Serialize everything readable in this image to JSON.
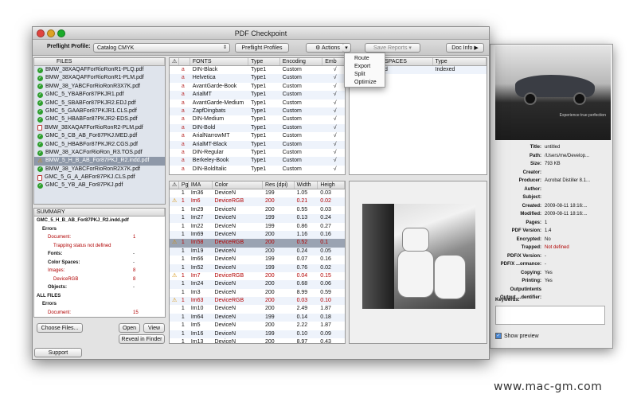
{
  "app": {
    "title": "PDF Checkpoint"
  },
  "toolbar": {
    "preflight_label": "Preflight Profile:",
    "profile_value": "Catalog CMYK",
    "preflight_profiles_button": "Preflight Profiles",
    "actions_button": "Actions",
    "save_reports_button": "Save Reports",
    "doc_info_button": "Doc Info"
  },
  "actions_menu": [
    "Route",
    "Export",
    "Split",
    "Optimize"
  ],
  "files": {
    "header": "FILES",
    "items": [
      {
        "name": "BMW_38XAQAFForRioRonR1-PLQ.pdf",
        "status": "ok"
      },
      {
        "name": "BMW_38XAQAFForRioRonR1-PLM.pdf",
        "status": "ok"
      },
      {
        "name": "BMW_38_YABCForRioRonR3X7K.pdf",
        "status": "ok"
      },
      {
        "name": "GMC_5_YBABFor87PKJR1.pdf",
        "status": "ok"
      },
      {
        "name": "GMC_5_SBABFor87PKJR2.EDJ.pdf",
        "status": "ok"
      },
      {
        "name": "GMC_5_GAABFor87PKJR1.CLS.pdf",
        "status": "ok"
      },
      {
        "name": "GMC_5_HBABFor87PKJR2-EDS.pdf",
        "status": "ok"
      },
      {
        "name": "BMW_38XAQAFForRioRonR2-PLM.pdf",
        "status": "pdf"
      },
      {
        "name": "GMC_5_CB_AB_For87PKJ.MED.pdf",
        "status": "ok"
      },
      {
        "name": "GMC_5_HBABFor87PKJR2.CGS.pdf",
        "status": "ok"
      },
      {
        "name": "BMW_38_XACForRioRon_R3.TOS.pdf",
        "status": "ok"
      },
      {
        "name": "BMW_5_H_B_AB_For87PKJ_R2.indd.pdf",
        "status": "warn",
        "selected": true
      },
      {
        "name": "BMW_38_YABCForRioRonR2X7K.pdf",
        "status": "ok"
      },
      {
        "name": "GMC_5_G_A_ABFor87PKJ.CLS.pdf",
        "status": "pdf"
      },
      {
        "name": "GMC_5_YB_AB_For87PKJ.pdf",
        "status": "ok"
      }
    ]
  },
  "summary": {
    "header": "SUMMARY",
    "rows": [
      {
        "name": "GMC_5_H_B_AB_For87PKJ_R2.indd.pdf",
        "count": "",
        "style": "title"
      },
      {
        "name": "Errors",
        "count": "",
        "style": "bold",
        "indent": 1
      },
      {
        "name": "Document:",
        "count": "1",
        "style": "red",
        "indent": 2
      },
      {
        "name": "Trapping status not defined",
        "count": "",
        "style": "red",
        "indent": 3
      },
      {
        "name": "Fonts:",
        "count": "-",
        "style": "bold",
        "indent": 2
      },
      {
        "name": "Color Spaces:",
        "count": "-",
        "style": "bold",
        "indent": 2
      },
      {
        "name": "Images:",
        "count": "8",
        "style": "red",
        "indent": 2
      },
      {
        "name": "DeviceRGB",
        "count": "8",
        "style": "red",
        "indent": 3
      },
      {
        "name": "Objects:",
        "count": "-",
        "style": "bold",
        "indent": 2
      },
      {
        "name": "ALL FILES",
        "count": "",
        "style": "bold",
        "indent": 0
      },
      {
        "name": "Errors",
        "count": "",
        "style": "bold",
        "indent": 1
      },
      {
        "name": "Document:",
        "count": "15",
        "style": "red",
        "indent": 2
      }
    ]
  },
  "buttons": {
    "choose_files": "Choose Files...",
    "open": "Open",
    "view": "View",
    "reveal": "Reveal in Finder",
    "support": "Support"
  },
  "fonts": {
    "columns": [
      "⚠",
      "FONTS",
      "Type",
      "Encoding",
      "Emb"
    ],
    "rows": [
      {
        "name": "DIN-Black",
        "type": "Type1",
        "enc": "Custom",
        "emb": "√"
      },
      {
        "name": "Helvetica",
        "type": "Type1",
        "enc": "Custom",
        "emb": "√"
      },
      {
        "name": "AvantGarde-Book",
        "type": "Type1",
        "enc": "Custom",
        "emb": "√"
      },
      {
        "name": "ArialMT",
        "type": "Type1",
        "enc": "Custom",
        "emb": "√"
      },
      {
        "name": "AvantGarde-Medium",
        "type": "Type1",
        "enc": "Custom",
        "emb": "√"
      },
      {
        "name": "ZapfDingbats",
        "type": "Type1",
        "enc": "Custom",
        "emb": "√"
      },
      {
        "name": "DIN-Medium",
        "type": "Type1",
        "enc": "Custom",
        "emb": "√"
      },
      {
        "name": "DIN-Bold",
        "type": "Type1",
        "enc": "Custom",
        "emb": "√"
      },
      {
        "name": "ArialNarrowMT",
        "type": "Type1",
        "enc": "Custom",
        "emb": "√"
      },
      {
        "name": "ArialMT-Black",
        "type": "Type1",
        "enc": "Custom",
        "emb": "√"
      },
      {
        "name": "DIN-Regular",
        "type": "Type1",
        "enc": "Custom",
        "emb": "√"
      },
      {
        "name": "Berkeley-Book",
        "type": "Type1",
        "enc": "Custom",
        "emb": "√"
      },
      {
        "name": "DIN-BoldItalic",
        "type": "Type1",
        "enc": "Custom",
        "emb": "√"
      }
    ]
  },
  "spaces": {
    "columns": [
      "SPACES",
      "Type"
    ],
    "rows": [
      {
        "name": "d",
        "type": "Indexed"
      }
    ]
  },
  "images": {
    "columns": [
      "⚠",
      "Pg",
      "IMA",
      "Color",
      "Res (dpi)",
      "Width",
      "Heigh"
    ],
    "rows": [
      {
        "warn": false,
        "pg": "1",
        "ima": "Im36",
        "color": "DeviceN",
        "res": "199",
        "w": "1.05",
        "h": "0.03"
      },
      {
        "warn": true,
        "pg": "1",
        "ima": "Im6",
        "color": "DeviceRGB",
        "res": "200",
        "w": "0.21",
        "h": "0.02"
      },
      {
        "warn": false,
        "pg": "1",
        "ima": "Im29",
        "color": "DeviceN",
        "res": "200",
        "w": "0.55",
        "h": "0.03"
      },
      {
        "warn": false,
        "pg": "1",
        "ima": "Im27",
        "color": "DeviceN",
        "res": "199",
        "w": "0.13",
        "h": "0.24"
      },
      {
        "warn": false,
        "pg": "1",
        "ima": "Im22",
        "color": "DeviceN",
        "res": "199",
        "w": "0.86",
        "h": "0.27"
      },
      {
        "warn": false,
        "pg": "1",
        "ima": "Im69",
        "color": "DeviceN",
        "res": "200",
        "w": "1.16",
        "h": "0.16"
      },
      {
        "warn": true,
        "pg": "1",
        "ima": "Im58",
        "color": "DeviceRGB",
        "res": "200",
        "w": "0.52",
        "h": "0.1",
        "selected": true
      },
      {
        "warn": false,
        "pg": "1",
        "ima": "Im19",
        "color": "DeviceN",
        "res": "200",
        "w": "0.24",
        "h": "0.05"
      },
      {
        "warn": false,
        "pg": "1",
        "ima": "Im66",
        "color": "DeviceN",
        "res": "199",
        "w": "0.07",
        "h": "0.16"
      },
      {
        "warn": false,
        "pg": "1",
        "ima": "Im52",
        "color": "DeviceN",
        "res": "199",
        "w": "0.76",
        "h": "0.02"
      },
      {
        "warn": true,
        "pg": "1",
        "ima": "Im7",
        "color": "DeviceRGB",
        "res": "200",
        "w": "0.04",
        "h": "0.15"
      },
      {
        "warn": false,
        "pg": "1",
        "ima": "Im24",
        "color": "DeviceN",
        "res": "200",
        "w": "0.68",
        "h": "0.06"
      },
      {
        "warn": false,
        "pg": "1",
        "ima": "Im3",
        "color": "DeviceN",
        "res": "200",
        "w": "8.99",
        "h": "0.59"
      },
      {
        "warn": true,
        "pg": "1",
        "ima": "Im63",
        "color": "DeviceRGB",
        "res": "200",
        "w": "0.03",
        "h": "0.10"
      },
      {
        "warn": false,
        "pg": "1",
        "ima": "Im10",
        "color": "DeviceN",
        "res": "200",
        "w": "2.49",
        "h": "1.87"
      },
      {
        "warn": false,
        "pg": "1",
        "ima": "Im64",
        "color": "DeviceN",
        "res": "199",
        "w": "0.14",
        "h": "0.18"
      },
      {
        "warn": false,
        "pg": "1",
        "ima": "Im5",
        "color": "DeviceN",
        "res": "200",
        "w": "2.22",
        "h": "1.87"
      },
      {
        "warn": false,
        "pg": "1",
        "ima": "Im16",
        "color": "DeviceN",
        "res": "199",
        "w": "0.10",
        "h": "0.09"
      },
      {
        "warn": false,
        "pg": "1",
        "ima": "Im13",
        "color": "DeviceN",
        "res": "200",
        "w": "8.97",
        "h": "0.43"
      }
    ]
  },
  "doc_info": {
    "photo_caption": "Experience true perfection",
    "rows": [
      {
        "k": "Title:",
        "v": "untitled"
      },
      {
        "k": "Path:",
        "v": "/Users/me/Develop..."
      },
      {
        "k": "Size:",
        "v": "793 KB"
      },
      {
        "k": "Creator:",
        "v": ""
      },
      {
        "k": "Producer:",
        "v": "Acrobat Distiller 8.1..."
      },
      {
        "k": "Author:",
        "v": ""
      },
      {
        "k": "Subject:",
        "v": ""
      },
      {
        "k": "Created:",
        "v": "2009-08-11 18:16:..."
      },
      {
        "k": "Modified:",
        "v": "2009-08-11 18:16:..."
      },
      {
        "k": "Pages:",
        "v": "1"
      },
      {
        "k": "PDF Version:",
        "v": "1.4"
      },
      {
        "k": "Encrypted:",
        "v": "No"
      },
      {
        "k": "Trapped:",
        "v": "Not defined",
        "red": true
      },
      {
        "k": "PDF/X Version:",
        "v": "-"
      },
      {
        "k": "PDF/X ...ormance:",
        "v": "-"
      },
      {
        "k": "Copying:",
        "v": "Yes"
      },
      {
        "k": "Printing:",
        "v": "Yes"
      },
      {
        "k": "Outputintents",
        "v": ""
      },
      {
        "k": "Output ...dentifier:",
        "v": ""
      }
    ],
    "keywords_label": "Keywords:",
    "show_preview_label": "Show preview",
    "show_preview_checked": "✓"
  },
  "watermark": "www.mac-gm.com"
}
